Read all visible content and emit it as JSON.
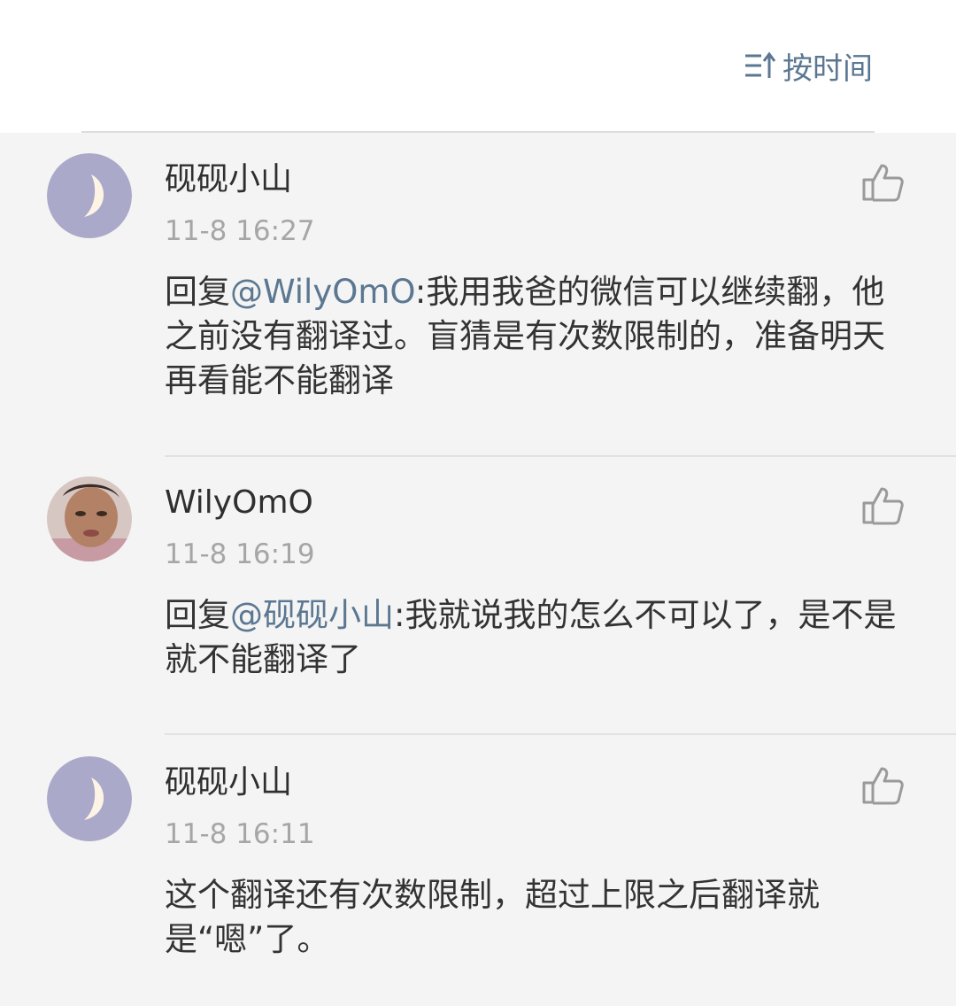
{
  "header": {
    "sort_label": "按时间",
    "sort_icon": "sort-ascending-icon"
  },
  "comments": [
    {
      "username": "砚砚小山",
      "time": "11-8 16:27",
      "reply_prefix": "回复",
      "mention": "@WilyOmO",
      "text": ":我用我爸的微信可以继续翻，他之前没有翻译过。盲猜是有次数限制的，准备明天再看能不能翻译",
      "avatar": "crescent-moon-avatar",
      "like_icon": "thumbs-up-icon"
    },
    {
      "username": "WilyOmO",
      "time": "11-8 16:19",
      "reply_prefix": "回复",
      "mention": "@砚砚小山",
      "text": ":我就说我的怎么不可以了，是不是就不能翻译了",
      "avatar": "user-photo-avatar",
      "like_icon": "thumbs-up-icon"
    },
    {
      "username": "砚砚小山",
      "time": "11-8 16:11",
      "text": "这个翻译还有次数限制，超过上限之后翻译就是“嗯”了。",
      "avatar": "crescent-moon-avatar",
      "like_icon": "thumbs-up-icon"
    }
  ],
  "colors": {
    "accent": "#5b7791",
    "background": "#f4f4f4",
    "username": "#2f2f2f",
    "timestamp": "#a6a6a6"
  }
}
